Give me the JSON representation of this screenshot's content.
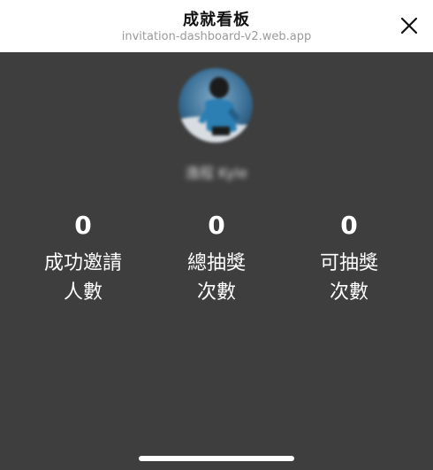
{
  "header": {
    "title": "成就看板",
    "url": "invitation-dashboard-v2.web.app",
    "close_icon": "close-icon"
  },
  "profile": {
    "name": "逸程 Kyle",
    "avatar": "avatar-photo"
  },
  "stats": [
    {
      "value": "0",
      "label_line1": "成功邀請",
      "label_line2": "人數"
    },
    {
      "value": "0",
      "label_line1": "總抽獎",
      "label_line2": "次數"
    },
    {
      "value": "0",
      "label_line1": "可抽獎",
      "label_line2": "次數"
    }
  ],
  "colors": {
    "background": "#3e3e3e",
    "header": "#ffffff",
    "text": "#ffffff"
  }
}
